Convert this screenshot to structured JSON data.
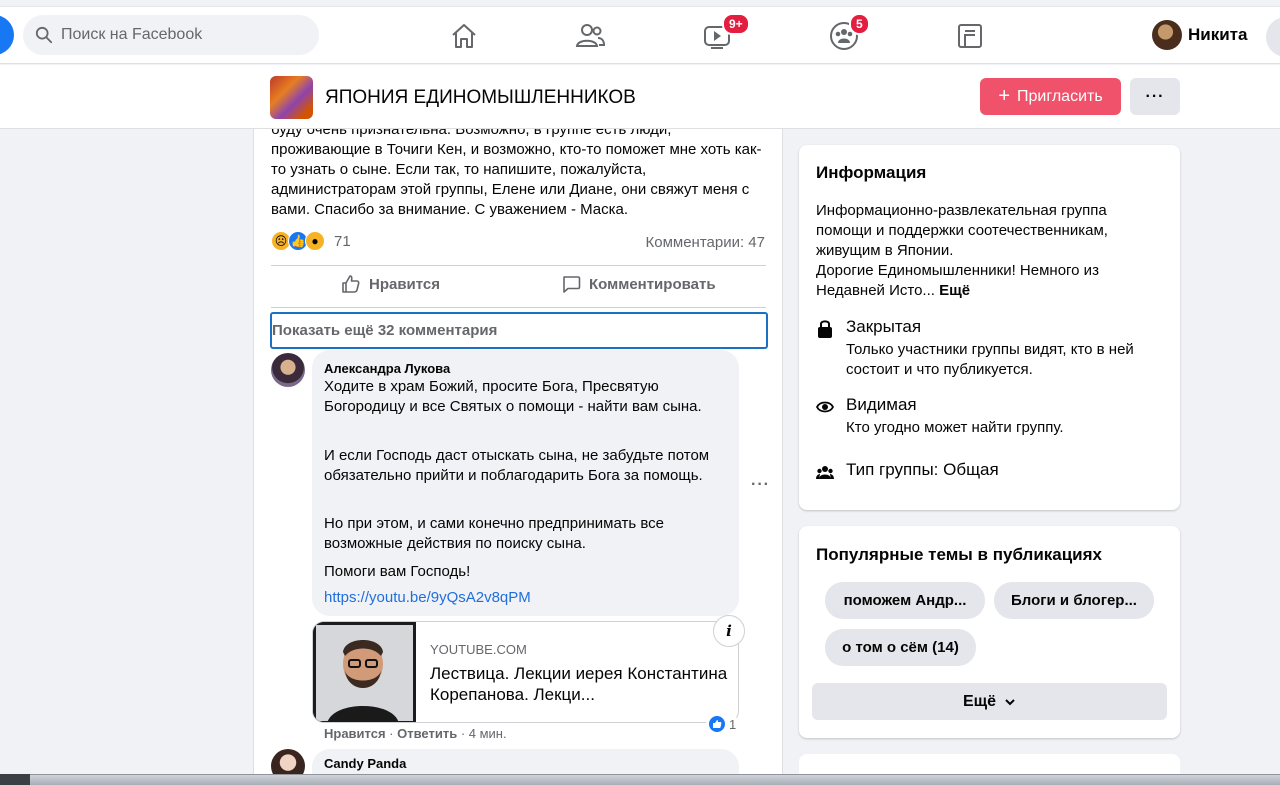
{
  "topbar": {
    "search_placeholder": "Поиск на Facebook",
    "nav": [
      {
        "name": "home",
        "badge": ""
      },
      {
        "name": "friends",
        "badge": ""
      },
      {
        "name": "watch",
        "badge": "9+"
      },
      {
        "name": "groups",
        "badge": "5"
      },
      {
        "name": "gaming",
        "badge": ""
      }
    ],
    "profile_name": "Никита"
  },
  "group": {
    "title": "ЯПОНИЯ ЕДИНОМЫШЛЕННИКОВ",
    "invite_label": "Пригласить",
    "invite_plus": "+",
    "more_label": "···"
  },
  "post": {
    "text": "буду очень признательна. Возможно, в группе есть люди, проживающие в Точиги Кен, и возможно, кто-то поможет мне хоть как-то узнать о сыне. Если так, то напишите, пожалуйста, администраторам этой группы, Елене или Диане, они свяжут меня с вами.  Спасибо за внимание. С уважением - Маска.",
    "reactions_count": "71",
    "comments_count": "Комментарии: 47",
    "like_label": "Нравится",
    "comment_label": "Комментировать",
    "show_more": "Показать ещё 32 комментария"
  },
  "comments": [
    {
      "author": "Александра Лукова",
      "paragraphs": [
        "Ходите в храм Божий, просите Бога, Пресвятую Богородицу и все Святых о помощи - найти вам сына.",
        "И если Господь даст отыскать сына, не забудьте потом обязательно прийти и поблагодарить Бога за помощь.",
        "Но при этом, и сами конечно предпринимать все возможные действия по поиску сына.",
        "Помоги вам Господь!"
      ],
      "link": "https://youtu.be/9yQsA2v8qPM",
      "preview": {
        "domain": "YOUTUBE.COM",
        "title": "Лествица. Лекции иерея Константина Корепанова. Лекци..."
      },
      "likes": "1",
      "actions": {
        "like": "Нравится",
        "reply": "Ответить",
        "time": "4 мин.",
        "sep": " · "
      }
    },
    {
      "author": "Candy Panda"
    }
  ],
  "sidebar": {
    "info": {
      "title": "Информация",
      "description": "Информационно-развлекательная группа помощи и поддержки соотечественникам, живущим в Японии.",
      "description2": "Дорогие Единомышленники! Немного из Недавней Исто...",
      "more": "Ещё",
      "private_title": "Закрытая",
      "private_desc": "Только участники группы видят, кто в ней состоит и что публикуется.",
      "visible_title": "Видимая",
      "visible_desc": "Кто угодно может найти группу.",
      "type": "Тип группы: Общая"
    },
    "topics": {
      "title": "Популярные темы в публикациях",
      "chips": [
        "поможем Андр...",
        "Блоги и блогер...",
        "о том о сём (14)"
      ],
      "more": "Ещё"
    }
  },
  "colors": {
    "accent": "#1877f2",
    "invite": "#f0516b",
    "badge": "#e41e3f",
    "link": "#216fdb"
  }
}
